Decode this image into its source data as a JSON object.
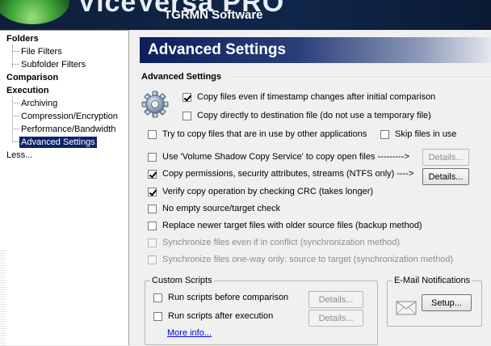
{
  "header": {
    "product_title": "ViceVersa PRO",
    "company": "TGRMN Software"
  },
  "tree": {
    "folders": "Folders",
    "file_filters": "File Filters",
    "subfolder_filters": "Subfolder Filters",
    "comparison": "Comparison",
    "execution": "Execution",
    "archiving": "Archiving",
    "compression": "Compression/Encryption",
    "performance": "Performance/Bandwidth",
    "advanced": "Advanced Settings",
    "less": "Less..."
  },
  "panel": {
    "title": "Advanced Settings",
    "group_title": "Advanced Settings",
    "options": {
      "copy_files_timestamp": {
        "label": "Copy files even if timestamp changes after initial comparison",
        "checked": true
      },
      "copy_directly": {
        "label": "Copy directly to destination file (do not use a temporary file)",
        "checked": false
      },
      "copy_in_use": {
        "label": "Try to copy files that are in use by other applications",
        "checked": false
      },
      "skip_in_use": {
        "label": "Skip files in use",
        "checked": false
      },
      "vss": {
        "label": "Use 'Volume Shadow Copy Service' to copy open files --------->",
        "checked": false
      },
      "copy_permissions": {
        "label": "Copy permissions, security attributes, streams (NTFS only) ---->",
        "checked": true
      },
      "verify_crc": {
        "label": "Verify copy operation by checking CRC (takes longer)",
        "checked": true
      },
      "no_empty_check": {
        "label": "No empty source/target check",
        "checked": false
      },
      "replace_newer": {
        "label": "Replace newer target files with older source files  (backup method)",
        "checked": false
      },
      "sync_conflict": {
        "label": "Synchronize files even if in conflict (synchronization method)",
        "checked": false
      },
      "sync_oneway": {
        "label": "Synchronize files one-way only: source to target (synchronization method)",
        "checked": false
      }
    },
    "details_label": "Details...",
    "custom_scripts": {
      "legend": "Custom Scripts",
      "before": "Run scripts before comparison",
      "after": "Run scripts after execution",
      "more_info": "More info..."
    },
    "email": {
      "legend": "E-Mail Notifications",
      "setup": "Setup..."
    }
  }
}
